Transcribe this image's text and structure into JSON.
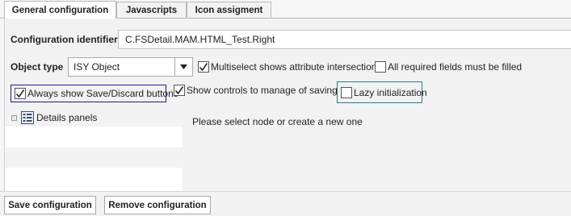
{
  "tabs": [
    {
      "label": "General configuration",
      "active": true
    },
    {
      "label": "Javascripts",
      "active": false
    },
    {
      "label": "Icon assigment",
      "active": false
    }
  ],
  "form": {
    "configuration_identifier": {
      "label": "Configuration identifier",
      "value": "C.FSDetail.MAM.HTML_Test.Right"
    },
    "object_type": {
      "label": "Object type",
      "selected": "ISY Object"
    },
    "checkboxes": {
      "multiselect": {
        "label": "Multiselect shows attribute intersection",
        "checked": true
      },
      "required": {
        "label": "All required fields must be filled",
        "checked": false
      },
      "always_show_save": {
        "label": "Always show Save/Discard buttons",
        "checked": true
      },
      "show_controls": {
        "label": "Show controls to manage of saving",
        "checked": true
      },
      "lazy_init": {
        "label": "Lazy initialization",
        "checked": false
      }
    }
  },
  "tree": {
    "items": [
      {
        "label": "Details panels",
        "icon": "details-panel-icon"
      }
    ]
  },
  "content": {
    "placeholder_message": "Please select node or create a new one"
  },
  "buttons": {
    "save": "Save configuration",
    "remove": "Remove configuration"
  },
  "colors": {
    "focus_border_save": "#1a1a9a",
    "focus_border_lazy": "#2a7f86",
    "panel_bg": "#f2f2f2"
  }
}
